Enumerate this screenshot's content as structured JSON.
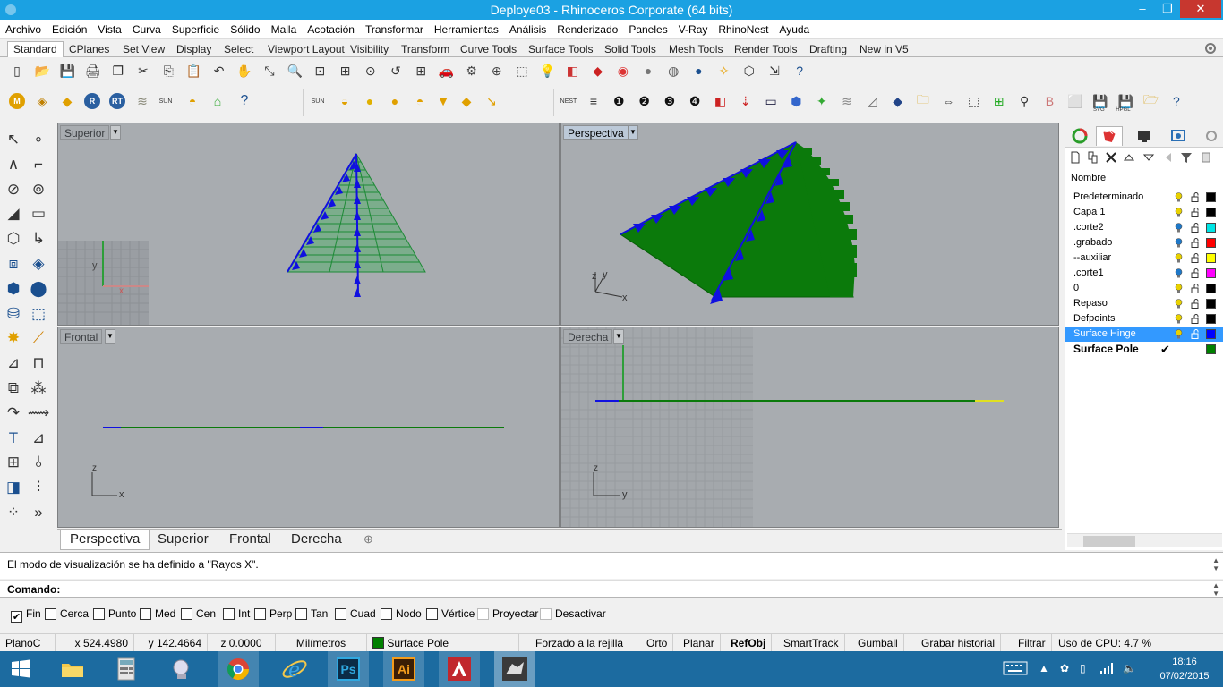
{
  "window": {
    "title": "Deploye03 - Rhinoceros Corporate (64 bits)",
    "minimize": "‒",
    "restore": "❐",
    "close": "✕"
  },
  "menu": [
    "Archivo",
    "Edición",
    "Vista",
    "Curva",
    "Superficie",
    "Sólido",
    "Malla",
    "Acotación",
    "Transformar",
    "Herramientas",
    "Análisis",
    "Renderizado",
    "Paneles",
    "V-Ray",
    "RhinoNest",
    "Ayuda"
  ],
  "toolbar_tabs": [
    "Standard",
    "CPlanes",
    "Set View",
    "Display",
    "Select",
    "Viewport Layout",
    "Visibility",
    "Transform",
    "Curve Tools",
    "Surface Tools",
    "Solid Tools",
    "Mesh Tools",
    "Render Tools",
    "Drafting",
    "New in V5"
  ],
  "toolbar_icons": {
    "row1": [
      "new-file-icon",
      "open-file-icon",
      "save-icon",
      "print-icon",
      "import-icon",
      "cut-icon",
      "copy-icon",
      "paste-icon",
      "undo-icon",
      "pan-icon",
      "rotate-view-icon",
      "zoom-icon",
      "zoom-window-icon",
      "zoom-extents-icon",
      "zoom-selected-icon",
      "undo-view-icon",
      "four-viewports-icon",
      "car-icon",
      "options-icon",
      "target-icon",
      "select-window-icon",
      "lightbulb-icon",
      "layer-icon",
      "material-icon",
      "color-wheel-icon",
      "render-preview-icon",
      "render-icon",
      "sphere-render-icon",
      "light-icon",
      "group-icon",
      "dimension-icon",
      "help-icon"
    ],
    "row2_labels": {
      "sun": "SUN",
      "nest": "NEST",
      "svg": "SVG",
      "hpgl": "HPGL",
      "m": "M",
      "r": "R",
      "rt": "RT"
    }
  },
  "viewports": {
    "top": {
      "label": "Superior",
      "axis_x": "x",
      "axis_y": "y"
    },
    "perspective": {
      "label": "Perspectiva",
      "axis_x": "x",
      "axis_y": "y",
      "axis_z": "z"
    },
    "front": {
      "label": "Frontal",
      "axis_x": "x",
      "axis_z": "z"
    },
    "right": {
      "label": "Derecha",
      "axis_y": "y",
      "axis_z": "z"
    }
  },
  "viewport_tabs": [
    "Perspectiva",
    "Superior",
    "Frontal",
    "Derecha"
  ],
  "viewport_tab_add": "⊕",
  "layers": {
    "column_header": "Nombre",
    "rows": [
      {
        "name": "Predeterminado",
        "bulb": "#e8d100",
        "color": "#000000"
      },
      {
        "name": "Capa 1",
        "bulb": "#e8d100",
        "color": "#000000"
      },
      {
        "name": ".corte2",
        "bulb": "#1e78c8",
        "color": "#00e5e5"
      },
      {
        "name": ".grabado",
        "bulb": "#1e78c8",
        "color": "#ff0000"
      },
      {
        "name": "--auxiliar",
        "bulb": "#e8d100",
        "color": "#ffff00"
      },
      {
        "name": ".corte1",
        "bulb": "#1e78c8",
        "color": "#ff00ff"
      },
      {
        "name": "0",
        "bulb": "#e8d100",
        "color": "#000000"
      },
      {
        "name": "Repaso",
        "bulb": "#e8d100",
        "color": "#000000"
      },
      {
        "name": "Defpoints",
        "bulb": "#e8d100",
        "color": "#000000"
      },
      {
        "name": "Surface Hinge",
        "bulb": "#e8d100",
        "color": "#0000ff",
        "selected": true
      },
      {
        "name": "Surface Pole",
        "bulb": "",
        "color": "#008000",
        "current": true,
        "check": "✔"
      }
    ]
  },
  "command": {
    "history": "El modo de visualización se ha definido a \"Rayos X\".",
    "prompt": "Comando:"
  },
  "osnaps": [
    {
      "label": "Fin",
      "checked": true
    },
    {
      "label": "Cerca",
      "checked": false
    },
    {
      "label": "Punto",
      "checked": false
    },
    {
      "label": "Med",
      "checked": false
    },
    {
      "label": "Cen",
      "checked": false
    },
    {
      "label": "Int",
      "checked": false
    },
    {
      "label": "Perp",
      "checked": false
    },
    {
      "label": "Tan",
      "checked": false
    },
    {
      "label": "Cuad",
      "checked": false
    },
    {
      "label": "Nodo",
      "checked": false
    },
    {
      "label": "Vértice",
      "checked": false
    },
    {
      "label": "Proyectar",
      "checked": false,
      "disabled": true
    },
    {
      "label": "Desactivar",
      "checked": false,
      "disabled": true
    }
  ],
  "status": {
    "cplane": "PlanoC",
    "x": "x 524.4980",
    "y": "y 142.4664",
    "z": "z 0.0000",
    "units": "Milímetros",
    "layer": "Surface Pole",
    "layer_color": "#008000",
    "grid_snap": "Forzado a la rejilla",
    "ortho": "Orto",
    "planar": "Planar",
    "osnap": "RefObj",
    "smarttrack": "SmartTrack",
    "gumball": "Gumball",
    "history": "Grabar historial",
    "filter": "Filtrar",
    "cpu": "Uso de CPU: 4.7 %"
  },
  "taskbar": {
    "apps": [
      "start-icon",
      "file-explorer-icon",
      "calculator-icon",
      "network-icon",
      "chrome-icon",
      "internet-explorer-icon",
      "photoshop-icon",
      "illustrator-icon",
      "autocad-icon",
      "rhino-icon"
    ],
    "ps": "Ps",
    "ai": "Ai",
    "time": "18:16",
    "date": "07/02/2015"
  },
  "colors": {
    "titlebar": "#1ba1e2",
    "viewport_bg": "#a8acb0",
    "surface_green": "#008000",
    "hinge_blue": "#0000ff",
    "selection": "#3399ff",
    "taskbar": "#1c6ba0"
  }
}
